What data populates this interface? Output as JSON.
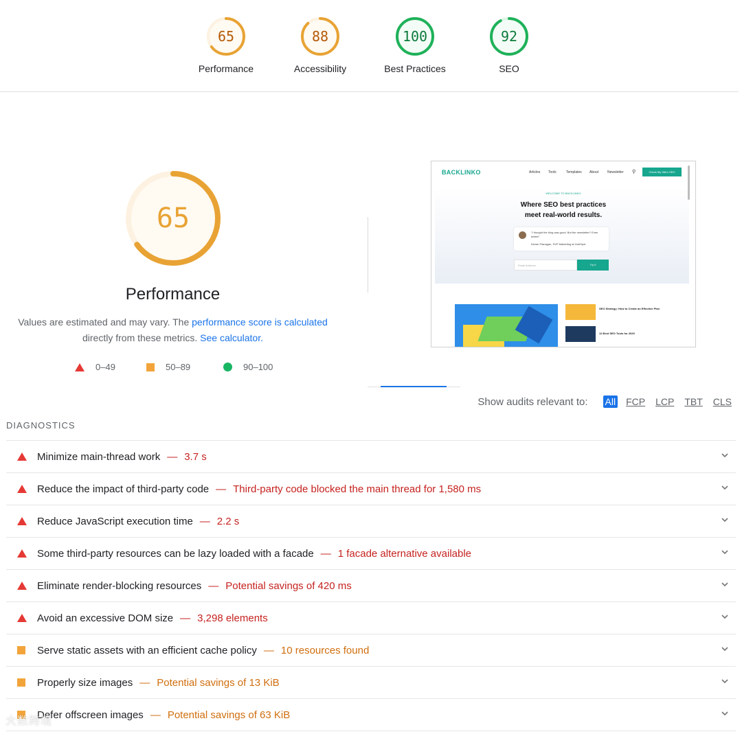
{
  "scores": [
    {
      "value": "65",
      "label": "Performance",
      "score": 65,
      "color": "#e8a334",
      "track": "#fdf2e1",
      "fill": "#fffaf2"
    },
    {
      "value": "88",
      "label": "Accessibility",
      "score": 88,
      "color": "#e8a334",
      "track": "#fdf2e1",
      "fill": "#fffaf2"
    },
    {
      "value": "100",
      "label": "Best Practices",
      "score": 100,
      "color": "#1fb15a",
      "track": "#def5e6",
      "fill": "#f3fcf6"
    },
    {
      "value": "92",
      "label": "SEO",
      "score": 92,
      "color": "#1fb15a",
      "track": "#def5e6",
      "fill": "#f3fcf6"
    }
  ],
  "performance": {
    "score": "65",
    "score_value": 65,
    "title": "Performance",
    "desc_prefix": "Values are estimated and may vary. The ",
    "desc_link": "performance score is calculated",
    "desc_middle": "directly from these metrics.",
    "desc_link2": "See calculator."
  },
  "legend": [
    {
      "range": "0–49",
      "symbol": "red-triangle"
    },
    {
      "range": "50–89",
      "symbol": "orange-square"
    },
    {
      "range": "90–100",
      "symbol": "green-circle"
    }
  ],
  "thumbnail": {
    "logo": "BACKLINKO",
    "nav": [
      "Articles",
      "Tools",
      "Templates",
      "About",
      "Newsletter"
    ],
    "cta": "Check My Site's SEO",
    "kicker": "WELCOME TO BACKLINKO",
    "headline_1": "Where SEO best practices",
    "headline_2": "meet real-world results.",
    "quote": "\"I thought the blog was good. But the newsletter? Even better!\"",
    "quote_author": "Kieran Flanagan, SVP Marketing at HubSpot",
    "email_placeholder": "Email Address",
    "try_button": "Try It",
    "article_1": "SEO Strategy: How to Create an Effective Plan",
    "article_2": "12 Best SEO Tools for 2025"
  },
  "filter": {
    "label": "Show audits relevant to:",
    "options": [
      "All",
      "FCP",
      "LCP",
      "TBT",
      "CLS"
    ],
    "active": "All"
  },
  "diagnostics_title": "DIAGNOSTICS",
  "audits": [
    {
      "title": "Minimize main-thread work",
      "detail": "3.7 s",
      "severity": "red"
    },
    {
      "title": "Reduce the impact of third-party code",
      "detail": "Third-party code blocked the main thread for 1,580 ms",
      "severity": "red"
    },
    {
      "title": "Reduce JavaScript execution time",
      "detail": "2.2 s",
      "severity": "red"
    },
    {
      "title": "Some third-party resources can be lazy loaded with a facade",
      "detail": "1 facade alternative available",
      "severity": "red"
    },
    {
      "title": "Eliminate render-blocking resources",
      "detail": "Potential savings of 420 ms",
      "severity": "red"
    },
    {
      "title": "Avoid an excessive DOM size",
      "detail": "3,298 elements",
      "severity": "red"
    },
    {
      "title": "Serve static assets with an efficient cache policy",
      "detail": "10 resources found",
      "severity": "orange"
    },
    {
      "title": "Properly size images",
      "detail": "Potential savings of 13 KiB",
      "severity": "orange"
    },
    {
      "title": "Defer offscreen images",
      "detail": "Potential savings of 63 KiB",
      "severity": "orange"
    }
  ],
  "separator": "—",
  "watermark": "大数跨境",
  "colors": {
    "red": "#e53935",
    "orange": "#f2a43a",
    "green": "#18b663",
    "link": "#1a73e8"
  }
}
